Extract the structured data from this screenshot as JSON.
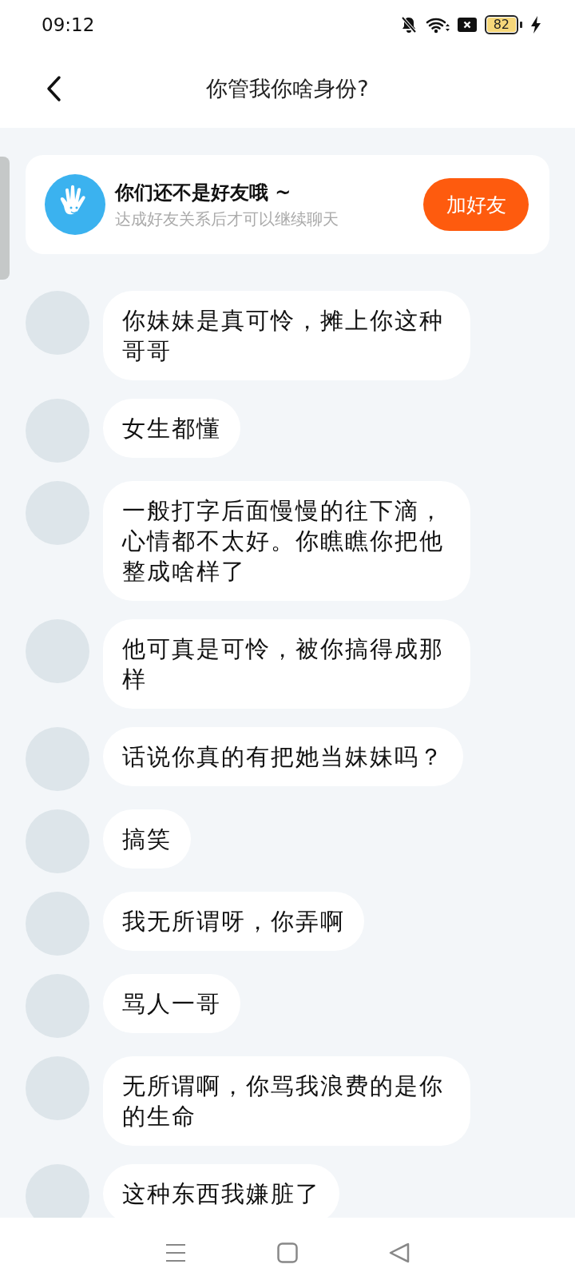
{
  "status_bar": {
    "time": "09:12",
    "battery": "82"
  },
  "header": {
    "title": "你管我你啥身份?"
  },
  "friend_notice": {
    "title": "你们还不是好友哦 ~",
    "subtitle": "达成好友关系后才可以继续聊天",
    "button": "加好友"
  },
  "messages": [
    {
      "text": "你妹妹是真可怜，摊上你这种哥哥"
    },
    {
      "text": "女生都懂"
    },
    {
      "text": "一般打字后面慢慢的往下滴，心情都不太好。你瞧瞧你把他整成啥样了"
    },
    {
      "text": "他可真是可怜，被你搞得成那样"
    },
    {
      "text": "话说你真的有把她当妹妹吗？"
    },
    {
      "text": "搞笑"
    },
    {
      "text": "我无所谓呀，你弄啊"
    },
    {
      "text": "骂人一哥"
    },
    {
      "text": "无所谓啊，你骂我浪费的是你的生命"
    },
    {
      "text": "这种东西我嫌脏了"
    }
  ]
}
